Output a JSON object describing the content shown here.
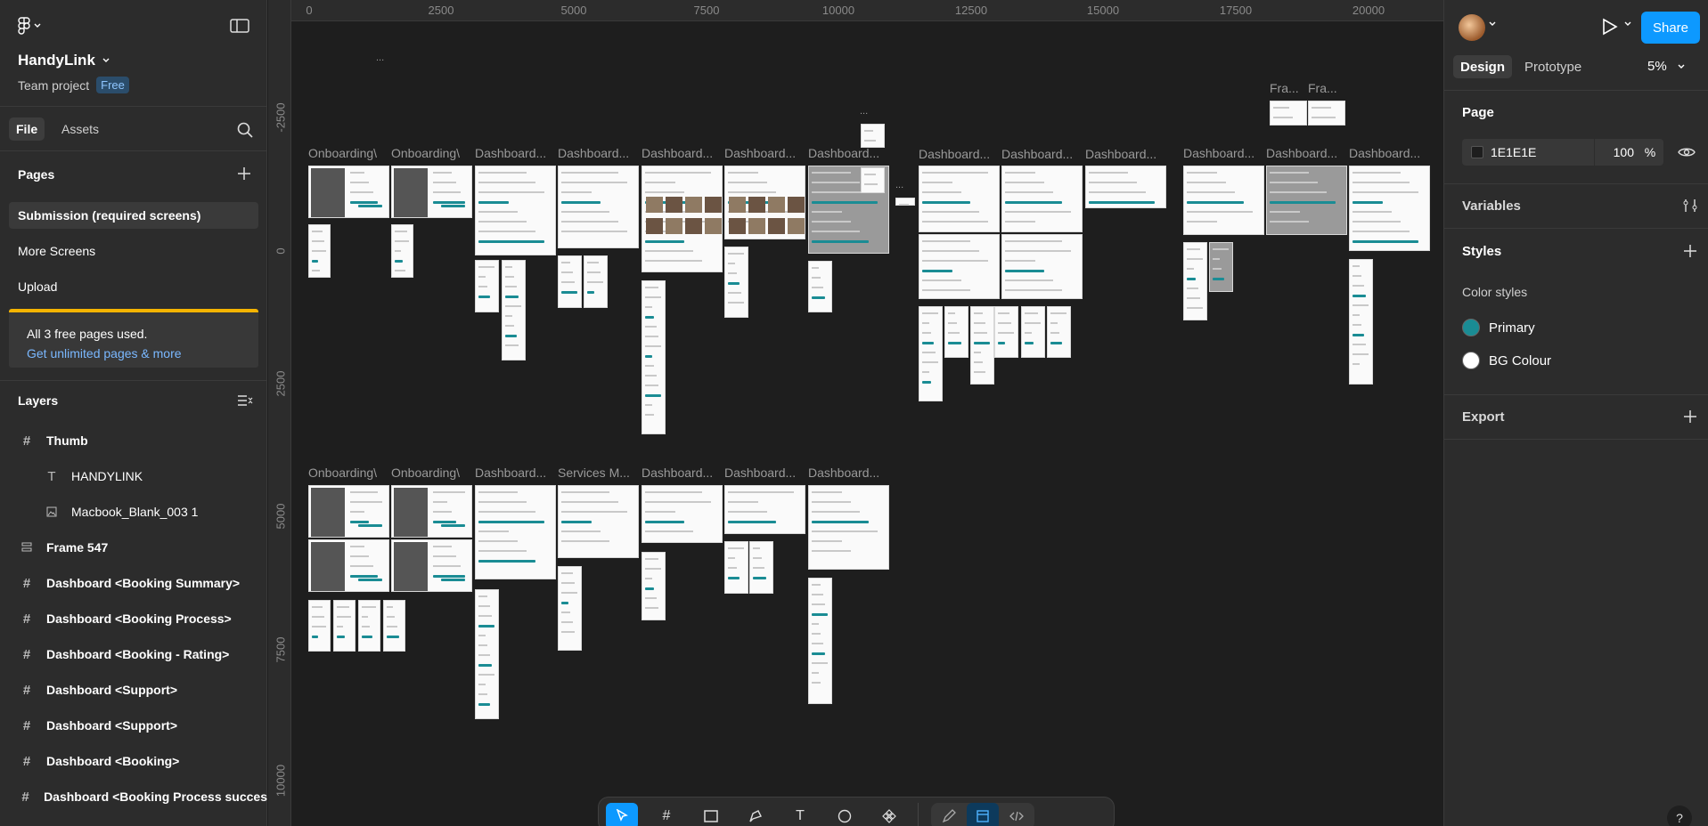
{
  "left": {
    "project_title": "HandyLink",
    "team_label": "Team project",
    "plan_badge": "Free",
    "tab_file": "File",
    "tab_assets": "Assets",
    "pages_heading": "Pages",
    "pages": [
      "Submission (required screens)",
      "More Screens",
      "Upload"
    ],
    "upgrade_text": "All 3 free pages used.",
    "upgrade_link": "Get unlimited pages & more",
    "layers_heading": "Layers",
    "layers": [
      {
        "name": "Thumb",
        "icon": "frame-icon"
      },
      {
        "name": "HANDYLINK",
        "icon": "text-icon"
      },
      {
        "name": "Macbook_Blank_003 1",
        "icon": "image-icon"
      },
      {
        "name": "Frame 547",
        "icon": "autolayout-icon"
      },
      {
        "name": "Dashboard <Booking Summary>",
        "icon": "frame-icon"
      },
      {
        "name": "Dashboard <Booking Process>",
        "icon": "frame-icon"
      },
      {
        "name": "Dashboard <Booking -  Rating>",
        "icon": "frame-icon"
      },
      {
        "name": "Dashboard <Support>",
        "icon": "frame-icon"
      },
      {
        "name": "Dashboard <Support>",
        "icon": "frame-icon"
      },
      {
        "name": "Dashboard <Booking>",
        "icon": "frame-icon"
      },
      {
        "name": "Dashboard <Booking Process succes",
        "icon": "frame-icon"
      }
    ]
  },
  "canvas": {
    "ruler_x": [
      "0",
      "2500",
      "5000",
      "7500",
      "10000",
      "12500",
      "15000",
      "17500",
      "20000"
    ],
    "ruler_y": [
      "-2500",
      "0",
      "2500",
      "5000",
      "7500",
      "10000"
    ],
    "ellipsis": "...",
    "row1_labels": [
      "Onboarding\\",
      "Onboarding\\",
      "Dashboard...",
      "Dashboard...",
      "Dashboard...",
      "Dashboard...",
      "Dashboard...",
      "Dashboard...",
      "Dashboard...",
      "Dashboard...",
      "Dashboard...",
      "Dashboard...",
      "Dashboard..."
    ],
    "row2_labels": [
      "Onboarding\\",
      "Onboarding\\",
      "Dashboard...",
      "Services M...",
      "Dashboard...",
      "Dashboard...",
      "Dashboard..."
    ],
    "top_labels": [
      "Fra...",
      "Fra..."
    ],
    "onboard_text": "Onbo"
  },
  "right": {
    "share": "Share",
    "tab_design": "Design",
    "tab_prototype": "Prototype",
    "zoom": "5%",
    "page_heading": "Page",
    "page_fill_hex": "1E1E1E",
    "page_fill_opacity": "100",
    "page_fill_unit": "%",
    "variables_heading": "Variables",
    "styles_heading": "Styles",
    "color_styles_heading": "Color styles",
    "color_styles": [
      {
        "name": "Primary",
        "color": "#1a8c94"
      },
      {
        "name": "BG Colour",
        "color": "#ffffff"
      }
    ],
    "export_heading": "Export",
    "help": "?"
  },
  "colors": {
    "accent": "#0d99ff",
    "brand_teal": "#1a8c94",
    "warning": "#f5b400"
  }
}
